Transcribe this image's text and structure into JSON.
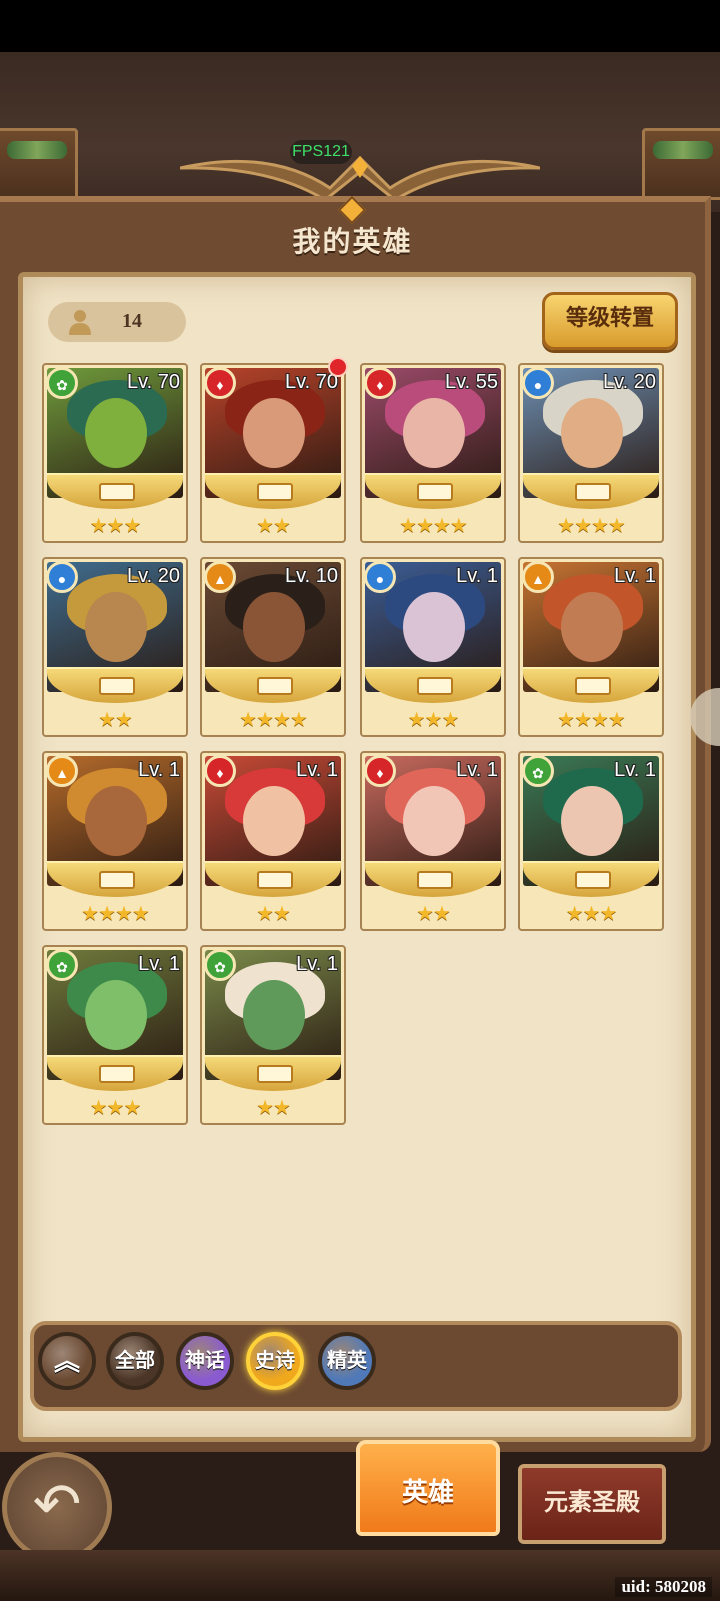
{
  "fps_label": "FPS121",
  "title": "我的英雄",
  "hero_count": "14",
  "level_transfer_label": "等级转置",
  "element_colors": {
    "nature": "#3fa33a",
    "fire": "#d7262a",
    "water": "#2f7fd6",
    "earth": "#e58a17"
  },
  "heroes": [
    {
      "level": "Lv. 70",
      "element": "nature",
      "stars": "★★★",
      "art_bg": "#6f9b3c",
      "skin": "#7fb03d",
      "hair": "#2a6b52",
      "notify": false
    },
    {
      "level": "Lv. 70",
      "element": "fire",
      "stars": "★★",
      "art_bg": "#b8432a",
      "skin": "#d89a78",
      "hair": "#8a2417",
      "notify": true
    },
    {
      "level": "Lv. 55",
      "element": "fire",
      "stars": "★★★★",
      "art_bg": "#9a4a68",
      "skin": "#e8b5a6",
      "hair": "#b94c7a",
      "notify": false
    },
    {
      "level": "Lv. 20",
      "element": "water",
      "stars": "★★★★",
      "art_bg": "#6d8fb3",
      "skin": "#e0ad84",
      "hair": "#d8d4c8",
      "notify": false
    },
    {
      "level": "Lv. 20",
      "element": "water",
      "stars": "★★",
      "art_bg": "#3f6d8f",
      "skin": "#b8864f",
      "hair": "#c49a3c",
      "notify": false
    },
    {
      "level": "Lv. 10",
      "element": "earth",
      "stars": "★★★★",
      "art_bg": "#6a4a34",
      "skin": "#8a5536",
      "hair": "#2b2019",
      "notify": false
    },
    {
      "level": "Lv. 1",
      "element": "water",
      "stars": "★★★",
      "art_bg": "#3b5d95",
      "skin": "#d9c3d4",
      "hair": "#2c4a80",
      "notify": false
    },
    {
      "level": "Lv. 1",
      "element": "earth",
      "stars": "★★★★",
      "art_bg": "#c77432",
      "skin": "#c17c54",
      "hair": "#c2562a",
      "notify": false
    },
    {
      "level": "Lv. 1",
      "element": "earth",
      "stars": "★★★★",
      "art_bg": "#b56b2b",
      "skin": "#a8683c",
      "hair": "#d08a2f",
      "notify": false
    },
    {
      "level": "Lv. 1",
      "element": "fire",
      "stars": "★★",
      "art_bg": "#c84a37",
      "skin": "#f0c1a3",
      "hair": "#d73a38",
      "notify": false
    },
    {
      "level": "Lv. 1",
      "element": "fire",
      "stars": "★★",
      "art_bg": "#c86a5e",
      "skin": "#f2c6b6",
      "hair": "#e0665a",
      "notify": false
    },
    {
      "level": "Lv. 1",
      "element": "nature",
      "stars": "★★★",
      "art_bg": "#3a7a55",
      "skin": "#ecc6b1",
      "hair": "#1f6a4d",
      "notify": false
    },
    {
      "level": "Lv. 1",
      "element": "nature",
      "stars": "★★★",
      "art_bg": "#6f7a3c",
      "skin": "#7fbf6a",
      "hair": "#3d8a4a",
      "notify": false
    },
    {
      "level": "Lv. 1",
      "element": "nature",
      "stars": "★★",
      "art_bg": "#7a8a4a",
      "skin": "#5f9a5a",
      "hair": "#efe2cf",
      "notify": false
    }
  ],
  "filters": [
    {
      "label": "",
      "icon": "double-chevron-up-icon",
      "bg": "#6b4a32"
    },
    {
      "label": "全部",
      "icon": "",
      "bg": "#4a3526"
    },
    {
      "label": "神话",
      "icon": "",
      "bg": "#8a5bd0"
    },
    {
      "label": "史诗",
      "icon": "",
      "bg": "#f0a81c"
    },
    {
      "label": "精英",
      "icon": "",
      "bg": "#4f79b8"
    }
  ],
  "tabs": {
    "hero": "英雄",
    "element_temple": "元素圣殿"
  },
  "uid": "uid: 580208"
}
